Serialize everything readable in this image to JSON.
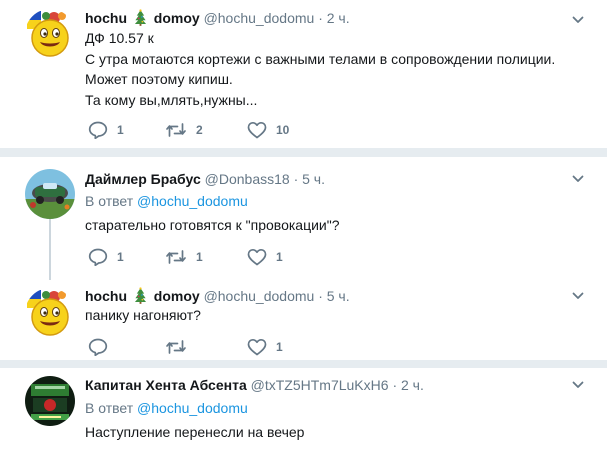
{
  "tweets": [
    {
      "name_a": "hochu",
      "name_b": "domoy",
      "handle": "@hochu_dodomu",
      "time": "· 2 ч.",
      "reply_prefix": "",
      "reply_handle": "",
      "lines": [
        "ДФ 10.57 к",
        "С утра мотаются кортежи с важными телами в сопровождении полиции.",
        "Может поэтому кипиш.",
        "Та кому вы,млять,нужны..."
      ],
      "replies": "1",
      "retweets": "2",
      "likes": "10"
    },
    {
      "name": "Даймлер Брабус",
      "handle": "@Donbass18",
      "time": "· 5 ч.",
      "reply_prefix": "В ответ",
      "reply_handle": "@hochu_dodomu",
      "lines": [
        "старательно готовятся к \"провокации\"?"
      ],
      "replies": "1",
      "retweets": "1",
      "likes": "1"
    },
    {
      "name_a": "hochu",
      "name_b": "domoy",
      "handle": "@hochu_dodomu",
      "time": "· 5 ч.",
      "lines": [
        "панику нагоняют?"
      ],
      "replies": "",
      "retweets": "",
      "likes": "1"
    },
    {
      "name": "Капитан Хента Абсента",
      "handle": "@txTZ5HTm7LuKxH6",
      "time": "· 2 ч.",
      "reply_prefix": "В ответ",
      "reply_handle": "@hochu_dodomu",
      "lines": [
        "Наступление перенесли на вечер"
      ]
    }
  ],
  "icons": {
    "reply": "reply-icon",
    "retweet": "retweet-icon",
    "like": "heart-icon",
    "more": "chevron-down-icon",
    "tree": "christmas-tree-icon"
  },
  "colors": {
    "text": "#14171a",
    "secondary": "#657786",
    "link": "#1b95e0",
    "separator": "#e6ecf0"
  }
}
